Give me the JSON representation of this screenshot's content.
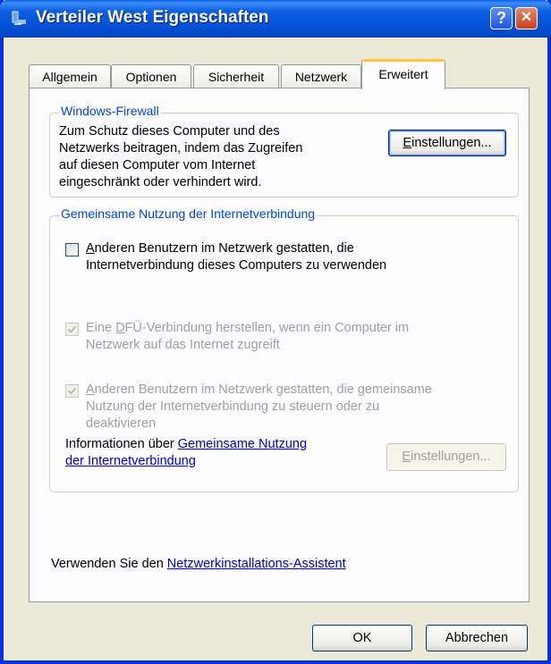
{
  "window": {
    "title": "Verteiler West Eigenschaften",
    "help_icon": "help-icon",
    "close_icon": "close-icon",
    "accent": "#0450d8"
  },
  "tabs": [
    {
      "label": "Allgemein"
    },
    {
      "label": "Optionen"
    },
    {
      "label": "Sicherheit"
    },
    {
      "label": "Netzwerk"
    },
    {
      "label": "Erweitert",
      "active": true
    }
  ],
  "firewall": {
    "label": "Windows-Firewall",
    "lines": [
      "Zum Schutz dieses Computer und des",
      "Netzwerks beitragen, indem das Zugreifen",
      "auf diesen Computer vom Internet",
      "eingeschränkt oder verhindert wird."
    ],
    "button_accel": "E",
    "button_rest": "instellungen..."
  },
  "ics": {
    "label": "Gemeinsame Nutzung der Internetverbindung",
    "option1": {
      "checked": false,
      "accel": "A",
      "line1_rest": "nderen Benutzern im Netzwerk gestatten, die",
      "line2": "Internetverbindung dieses Computers zu verwenden"
    },
    "option2": {
      "checked": true,
      "enabled": false,
      "line1_pre": "Eine ",
      "line1_accel": "D",
      "line1_rest": "FÜ-Verbindung herstellen, wenn ein Computer im",
      "line2": "Netzwerk auf das Internet zugreift"
    },
    "option3": {
      "checked": true,
      "enabled": false,
      "accel": "A",
      "line1_rest": "nderen Benutzern im Netzwerk gestatten, die gemeinsame",
      "line2": "Nutzung der Internetverbindung zu steuern oder zu",
      "line3": "deaktivieren"
    },
    "info_text": "Informationen über ",
    "info_link1": "Gemeinsame Nutzung",
    "info_link2": "der Internetverbindung",
    "button_accel": "E",
    "button_rest": "instellungen..."
  },
  "wizard": {
    "text": "Verwenden Sie den ",
    "link": "Netzwerkinstallations-Assistent"
  },
  "footer": {
    "ok_label": "OK",
    "cancel_label": "Abbrechen"
  }
}
